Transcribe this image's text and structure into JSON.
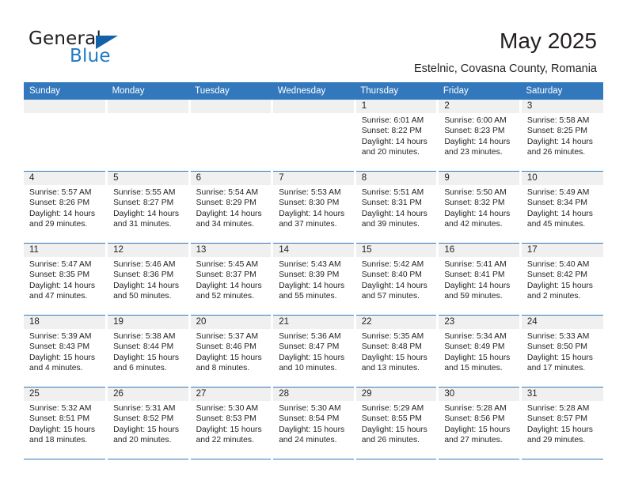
{
  "brand": {
    "name_part1": "General",
    "name_part2": "Blue",
    "triangle_color": "#1361a8",
    "blue_color": "#1f7ac4"
  },
  "header": {
    "title": "May 2025",
    "subtitle": "Estelnic, Covasna County, Romania",
    "header_bg": "#3378bc",
    "header_text_color": "#ffffff",
    "daynum_band_color": "#f0f0f0"
  },
  "weekdays": [
    "Sunday",
    "Monday",
    "Tuesday",
    "Wednesday",
    "Thursday",
    "Friday",
    "Saturday"
  ],
  "labels": {
    "sunrise_prefix": "Sunrise: ",
    "sunset_prefix": "Sunset: ",
    "daylight_prefix": "Daylight: "
  },
  "weeks": [
    [
      {
        "day": "",
        "empty": true
      },
      {
        "day": "",
        "empty": true
      },
      {
        "day": "",
        "empty": true
      },
      {
        "day": "",
        "empty": true
      },
      {
        "day": "1",
        "sunrise": "Sunrise: 6:01 AM",
        "sunset": "Sunset: 8:22 PM",
        "daylight": "Daylight: 14 hours and 20 minutes."
      },
      {
        "day": "2",
        "sunrise": "Sunrise: 6:00 AM",
        "sunset": "Sunset: 8:23 PM",
        "daylight": "Daylight: 14 hours and 23 minutes."
      },
      {
        "day": "3",
        "sunrise": "Sunrise: 5:58 AM",
        "sunset": "Sunset: 8:25 PM",
        "daylight": "Daylight: 14 hours and 26 minutes."
      }
    ],
    [
      {
        "day": "4",
        "sunrise": "Sunrise: 5:57 AM",
        "sunset": "Sunset: 8:26 PM",
        "daylight": "Daylight: 14 hours and 29 minutes."
      },
      {
        "day": "5",
        "sunrise": "Sunrise: 5:55 AM",
        "sunset": "Sunset: 8:27 PM",
        "daylight": "Daylight: 14 hours and 31 minutes."
      },
      {
        "day": "6",
        "sunrise": "Sunrise: 5:54 AM",
        "sunset": "Sunset: 8:29 PM",
        "daylight": "Daylight: 14 hours and 34 minutes."
      },
      {
        "day": "7",
        "sunrise": "Sunrise: 5:53 AM",
        "sunset": "Sunset: 8:30 PM",
        "daylight": "Daylight: 14 hours and 37 minutes."
      },
      {
        "day": "8",
        "sunrise": "Sunrise: 5:51 AM",
        "sunset": "Sunset: 8:31 PM",
        "daylight": "Daylight: 14 hours and 39 minutes."
      },
      {
        "day": "9",
        "sunrise": "Sunrise: 5:50 AM",
        "sunset": "Sunset: 8:32 PM",
        "daylight": "Daylight: 14 hours and 42 minutes."
      },
      {
        "day": "10",
        "sunrise": "Sunrise: 5:49 AM",
        "sunset": "Sunset: 8:34 PM",
        "daylight": "Daylight: 14 hours and 45 minutes."
      }
    ],
    [
      {
        "day": "11",
        "sunrise": "Sunrise: 5:47 AM",
        "sunset": "Sunset: 8:35 PM",
        "daylight": "Daylight: 14 hours and 47 minutes."
      },
      {
        "day": "12",
        "sunrise": "Sunrise: 5:46 AM",
        "sunset": "Sunset: 8:36 PM",
        "daylight": "Daylight: 14 hours and 50 minutes."
      },
      {
        "day": "13",
        "sunrise": "Sunrise: 5:45 AM",
        "sunset": "Sunset: 8:37 PM",
        "daylight": "Daylight: 14 hours and 52 minutes."
      },
      {
        "day": "14",
        "sunrise": "Sunrise: 5:43 AM",
        "sunset": "Sunset: 8:39 PM",
        "daylight": "Daylight: 14 hours and 55 minutes."
      },
      {
        "day": "15",
        "sunrise": "Sunrise: 5:42 AM",
        "sunset": "Sunset: 8:40 PM",
        "daylight": "Daylight: 14 hours and 57 minutes."
      },
      {
        "day": "16",
        "sunrise": "Sunrise: 5:41 AM",
        "sunset": "Sunset: 8:41 PM",
        "daylight": "Daylight: 14 hours and 59 minutes."
      },
      {
        "day": "17",
        "sunrise": "Sunrise: 5:40 AM",
        "sunset": "Sunset: 8:42 PM",
        "daylight": "Daylight: 15 hours and 2 minutes."
      }
    ],
    [
      {
        "day": "18",
        "sunrise": "Sunrise: 5:39 AM",
        "sunset": "Sunset: 8:43 PM",
        "daylight": "Daylight: 15 hours and 4 minutes."
      },
      {
        "day": "19",
        "sunrise": "Sunrise: 5:38 AM",
        "sunset": "Sunset: 8:44 PM",
        "daylight": "Daylight: 15 hours and 6 minutes."
      },
      {
        "day": "20",
        "sunrise": "Sunrise: 5:37 AM",
        "sunset": "Sunset: 8:46 PM",
        "daylight": "Daylight: 15 hours and 8 minutes."
      },
      {
        "day": "21",
        "sunrise": "Sunrise: 5:36 AM",
        "sunset": "Sunset: 8:47 PM",
        "daylight": "Daylight: 15 hours and 10 minutes."
      },
      {
        "day": "22",
        "sunrise": "Sunrise: 5:35 AM",
        "sunset": "Sunset: 8:48 PM",
        "daylight": "Daylight: 15 hours and 13 minutes."
      },
      {
        "day": "23",
        "sunrise": "Sunrise: 5:34 AM",
        "sunset": "Sunset: 8:49 PM",
        "daylight": "Daylight: 15 hours and 15 minutes."
      },
      {
        "day": "24",
        "sunrise": "Sunrise: 5:33 AM",
        "sunset": "Sunset: 8:50 PM",
        "daylight": "Daylight: 15 hours and 17 minutes."
      }
    ],
    [
      {
        "day": "25",
        "sunrise": "Sunrise: 5:32 AM",
        "sunset": "Sunset: 8:51 PM",
        "daylight": "Daylight: 15 hours and 18 minutes."
      },
      {
        "day": "26",
        "sunrise": "Sunrise: 5:31 AM",
        "sunset": "Sunset: 8:52 PM",
        "daylight": "Daylight: 15 hours and 20 minutes."
      },
      {
        "day": "27",
        "sunrise": "Sunrise: 5:30 AM",
        "sunset": "Sunset: 8:53 PM",
        "daylight": "Daylight: 15 hours and 22 minutes."
      },
      {
        "day": "28",
        "sunrise": "Sunrise: 5:30 AM",
        "sunset": "Sunset: 8:54 PM",
        "daylight": "Daylight: 15 hours and 24 minutes."
      },
      {
        "day": "29",
        "sunrise": "Sunrise: 5:29 AM",
        "sunset": "Sunset: 8:55 PM",
        "daylight": "Daylight: 15 hours and 26 minutes."
      },
      {
        "day": "30",
        "sunrise": "Sunrise: 5:28 AM",
        "sunset": "Sunset: 8:56 PM",
        "daylight": "Daylight: 15 hours and 27 minutes."
      },
      {
        "day": "31",
        "sunrise": "Sunrise: 5:28 AM",
        "sunset": "Sunset: 8:57 PM",
        "daylight": "Daylight: 15 hours and 29 minutes."
      }
    ]
  ]
}
